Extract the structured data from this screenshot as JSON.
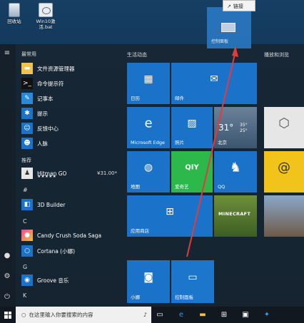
{
  "desktop": {
    "icons": [
      {
        "label": "回收站"
      },
      {
        "label": "Win10激活.bat"
      }
    ]
  },
  "drag": {
    "tile_label": "控制面板",
    "tooltip": "链接"
  },
  "start": {
    "most_used_header": "最常用",
    "apps_most_used": [
      {
        "label": "文件资源管理器",
        "icon": "folder-icon"
      },
      {
        "label": "命令提示符",
        "icon": "cmd-icon"
      },
      {
        "label": "记事本",
        "icon": "notepad-icon"
      },
      {
        "label": "提示",
        "icon": "bulb-icon"
      },
      {
        "label": "反馈中心",
        "icon": "feedback-icon"
      },
      {
        "label": "人脉",
        "icon": "people-icon"
      }
    ],
    "suggested_header": "推荐",
    "suggested": {
      "name": "Hitman GO",
      "price": "¥31.00*",
      "stars": "★★★★★"
    },
    "groups": [
      {
        "letter": "#",
        "apps": [
          {
            "label": "3D Builder"
          }
        ]
      },
      {
        "letter": "C",
        "apps": [
          {
            "label": "Candy Crush Soda Saga"
          },
          {
            "label": "Cortana (小娜)"
          }
        ]
      },
      {
        "letter": "G",
        "apps": [
          {
            "label": "Groove 音乐"
          }
        ]
      },
      {
        "letter": "K",
        "apps": []
      }
    ],
    "tiles_header_create": "生活动态",
    "tiles_header_play": "播放和浏览",
    "tiles": {
      "calendar": "日历",
      "mail": "邮件",
      "edge": "Microsoft Edge",
      "photos": "照片",
      "weather_temp": "31°",
      "weather_high": "35°",
      "weather_low": "25°",
      "weather_city": "北京",
      "maps": "地图",
      "iqiyi": "爱奇艺",
      "qq": "QQ",
      "store": "应用商店",
      "minecraft": "MINECRAFT",
      "cortana": "小娜",
      "control_panel": "控制面板"
    }
  },
  "taskbar": {
    "search_placeholder": "在这里输入你要搜索的内容"
  }
}
